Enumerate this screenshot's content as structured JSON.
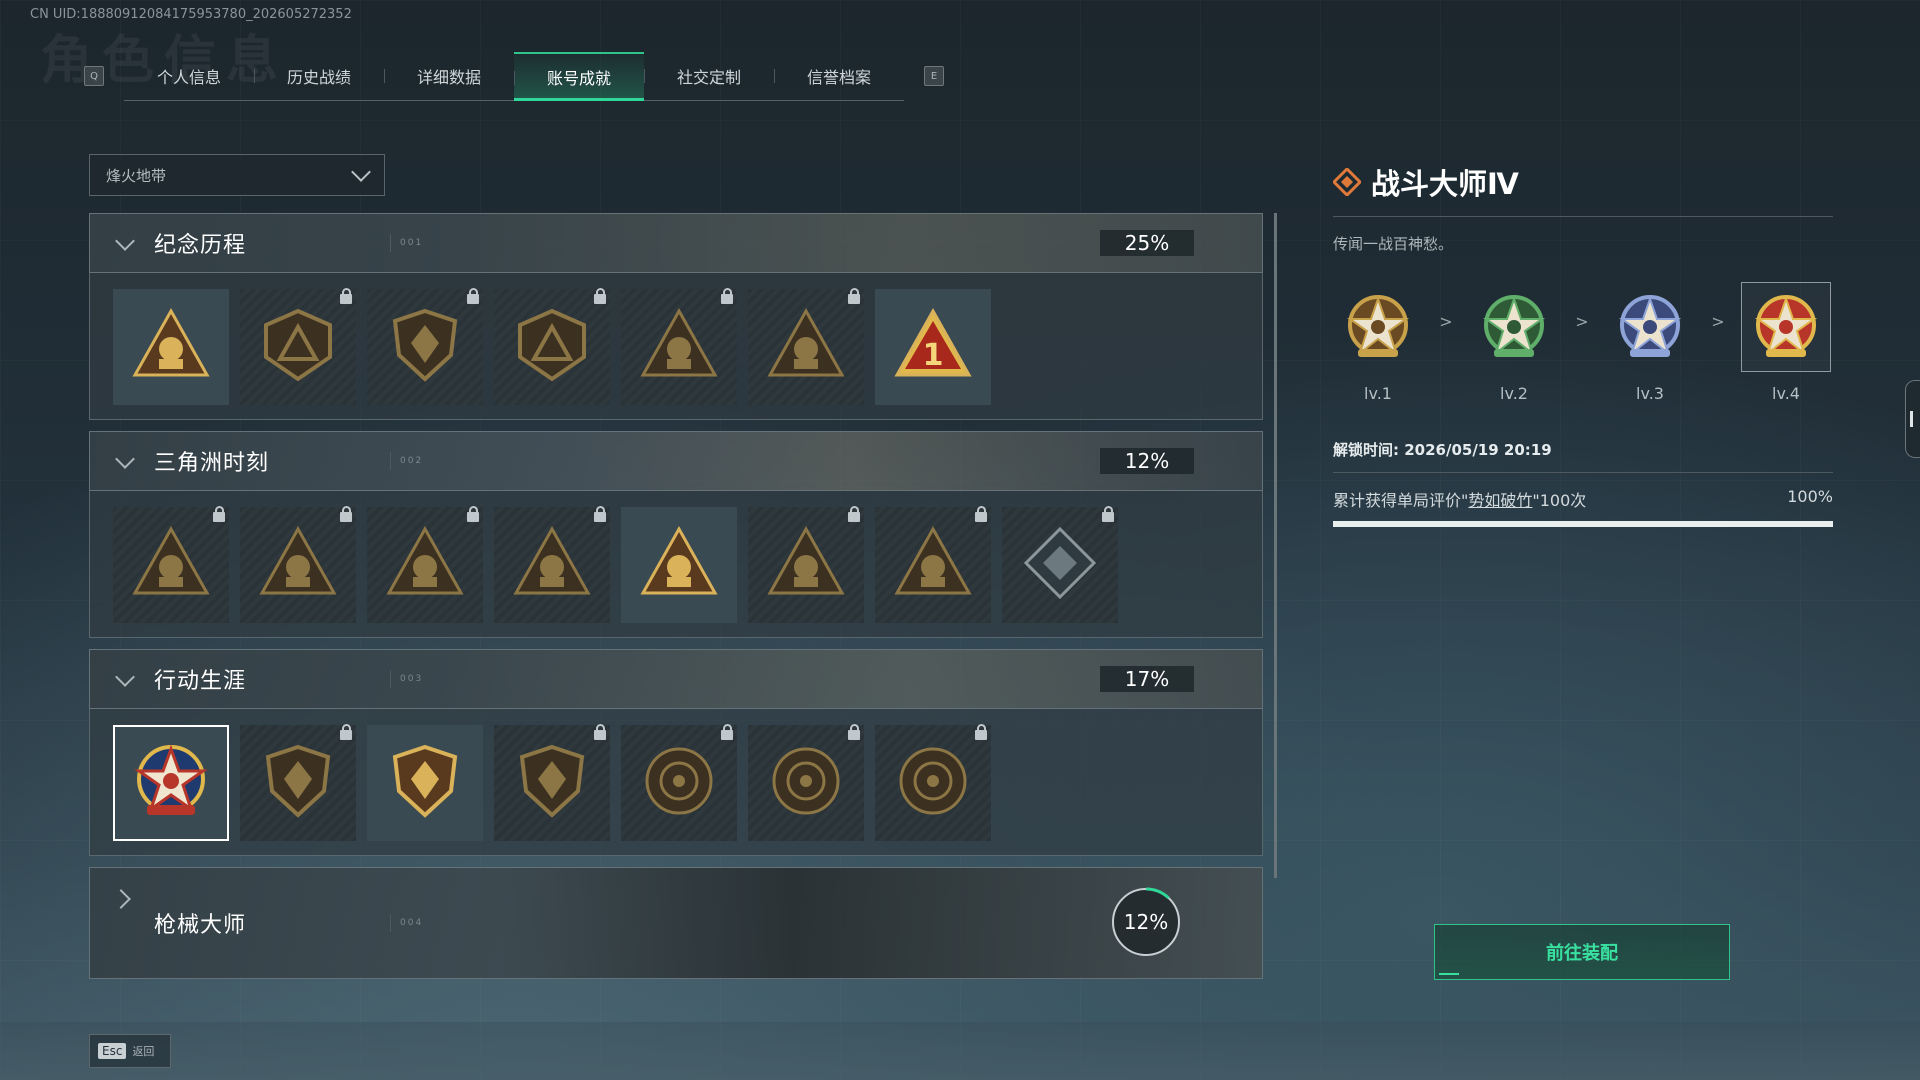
{
  "uid": "CN UID:18880912084175953780_202605272352",
  "bg_title": "角色信息",
  "tabbar": {
    "left_key": "Q",
    "right_key": "E",
    "tabs": [
      {
        "label": "个人信息",
        "active": false
      },
      {
        "label": "历史战绩",
        "active": false
      },
      {
        "label": "详细数据",
        "active": false
      },
      {
        "label": "账号成就",
        "active": true
      },
      {
        "label": "社交定制",
        "active": false
      },
      {
        "label": "信誉档案",
        "active": false
      }
    ]
  },
  "dropdown": {
    "value": "烽火地带"
  },
  "sections": [
    {
      "title": "纪念历程",
      "code": "001",
      "percent": "25%",
      "expanded": true,
      "badges": [
        {
          "icon": "delta-triangle-emblem-icon",
          "locked": false
        },
        {
          "icon": "helicopter-emblem-icon",
          "locked": true
        },
        {
          "icon": "shield-rune-emblem-icon",
          "locked": true
        },
        {
          "icon": "turret-emblem-icon",
          "locked": true
        },
        {
          "icon": "skull-triangle-emblem-icon",
          "locked": true
        },
        {
          "icon": "soldier-triangle-emblem-icon",
          "locked": true
        },
        {
          "icon": "number-one-triangle-icon",
          "locked": false
        }
      ]
    },
    {
      "title": "三角洲时刻",
      "code": "002",
      "percent": "12%",
      "expanded": true,
      "badges": [
        {
          "icon": "backpack-triangle-icon",
          "locked": true
        },
        {
          "icon": "vest-triangle-icon",
          "locked": true
        },
        {
          "icon": "soldier-kneel-triangle-icon",
          "locked": true
        },
        {
          "icon": "gem-triangle-icon",
          "locked": true
        },
        {
          "icon": "squad-triangle-icon",
          "locked": false
        },
        {
          "icon": "warrior-triangle-icon",
          "locked": true
        },
        {
          "icon": "dragon-triangle-icon",
          "locked": true
        },
        {
          "icon": "cube-diamond-icon",
          "locked": true
        }
      ]
    },
    {
      "title": "行动生涯",
      "code": "003",
      "percent": "17%",
      "expanded": true,
      "badges": [
        {
          "icon": "combat-master-star-icon",
          "locked": false,
          "selected": true
        },
        {
          "icon": "chevron-shield-icon",
          "locked": true
        },
        {
          "icon": "dagger-shield-icon",
          "locked": false
        },
        {
          "icon": "hex-shield-icon",
          "locked": true
        },
        {
          "icon": "helmet-circle-icon",
          "locked": true
        },
        {
          "icon": "skull-circle-icon",
          "locked": true
        },
        {
          "icon": "eye-circle-icon",
          "locked": true
        }
      ]
    },
    {
      "title": "枪械大师",
      "code": "004",
      "percent": "12%",
      "percent_value": 0.12,
      "expanded": false
    }
  ],
  "detail": {
    "title": "战斗大师Ⅳ",
    "description": "传闻一战百神愁。",
    "levels": [
      {
        "label": "lv.1",
        "color": "#c8a24a",
        "accent": "#6a4a22"
      },
      {
        "label": "lv.2",
        "color": "#5fae6a",
        "accent": "#2f5a36"
      },
      {
        "label": "lv.3",
        "color": "#8ea4d8",
        "accent": "#3b4a7a"
      },
      {
        "label": "lv.4",
        "color": "#e0b84c",
        "accent": "#b8352a"
      }
    ],
    "separator": ">",
    "unlock_time": "解锁时间: 2026/05/19 20:19",
    "requirement_prefix": "累计获得单局评价\"",
    "requirement_link": "势如破竹",
    "requirement_suffix": "\"100次",
    "requirement_percent": "100%",
    "requirement_progress": 1.0,
    "equip_button": "前往装配"
  },
  "footer": {
    "esc_key": "Esc",
    "esc_label": "返回"
  },
  "colors": {
    "accent": "#2fd898",
    "title_icon": "#e07a3a"
  }
}
